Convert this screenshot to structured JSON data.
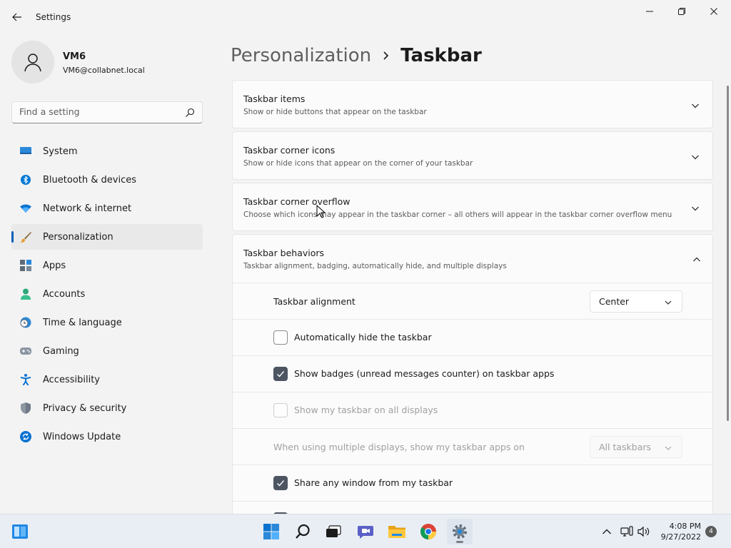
{
  "window": {
    "title": "Settings"
  },
  "profile": {
    "name": "VM6",
    "email": "VM6@collabnet.local"
  },
  "search": {
    "placeholder": "Find a setting"
  },
  "sidebar": {
    "items": [
      {
        "label": "System",
        "icon": "monitor-icon"
      },
      {
        "label": "Bluetooth & devices",
        "icon": "bluetooth-icon"
      },
      {
        "label": "Network & internet",
        "icon": "wifi-icon"
      },
      {
        "label": "Personalization",
        "icon": "paintbrush-icon",
        "active": true
      },
      {
        "label": "Apps",
        "icon": "apps-icon"
      },
      {
        "label": "Accounts",
        "icon": "person-icon"
      },
      {
        "label": "Time & language",
        "icon": "clock-globe-icon"
      },
      {
        "label": "Gaming",
        "icon": "gamepad-icon"
      },
      {
        "label": "Accessibility",
        "icon": "accessibility-icon"
      },
      {
        "label": "Privacy & security",
        "icon": "shield-icon"
      },
      {
        "label": "Windows Update",
        "icon": "update-icon"
      }
    ]
  },
  "breadcrumb": {
    "parent": "Personalization",
    "current": "Taskbar"
  },
  "sections": [
    {
      "title": "Taskbar items",
      "description": "Show or hide buttons that appear on the taskbar",
      "expanded": false
    },
    {
      "title": "Taskbar corner icons",
      "description": "Show or hide icons that appear on the corner of your taskbar",
      "expanded": false
    },
    {
      "title": "Taskbar corner overflow",
      "description": "Choose which icons may appear in the taskbar corner – all others will appear in the taskbar corner overflow menu",
      "expanded": false
    },
    {
      "title": "Taskbar behaviors",
      "description": "Taskbar alignment, badging, automatically hide, and multiple displays",
      "expanded": true
    }
  ],
  "behaviors": {
    "alignment": {
      "label": "Taskbar alignment",
      "value": "Center"
    },
    "auto_hide": {
      "label": "Automatically hide the taskbar",
      "checked": false
    },
    "badges": {
      "label": "Show badges (unread messages counter) on taskbar apps",
      "checked": true
    },
    "all_displays": {
      "label": "Show my taskbar on all displays",
      "checked": false,
      "disabled": true
    },
    "multi_display": {
      "label": "When using multiple displays, show my taskbar apps on",
      "value": "All taskbars",
      "disabled": true
    },
    "share_window": {
      "label": "Share any window from my taskbar",
      "checked": true
    }
  },
  "taskbar": {
    "apps": [
      "widgets-icon",
      "start-icon",
      "search-icon",
      "task-view-icon",
      "chat-icon",
      "file-explorer-icon",
      "chrome-icon",
      "settings-icon"
    ],
    "time": "4:08 PM",
    "date": "9/27/2022",
    "notification_count": "4"
  },
  "colors": {
    "accent": "#005fb8",
    "checkbox_checked": "#4d5562"
  }
}
